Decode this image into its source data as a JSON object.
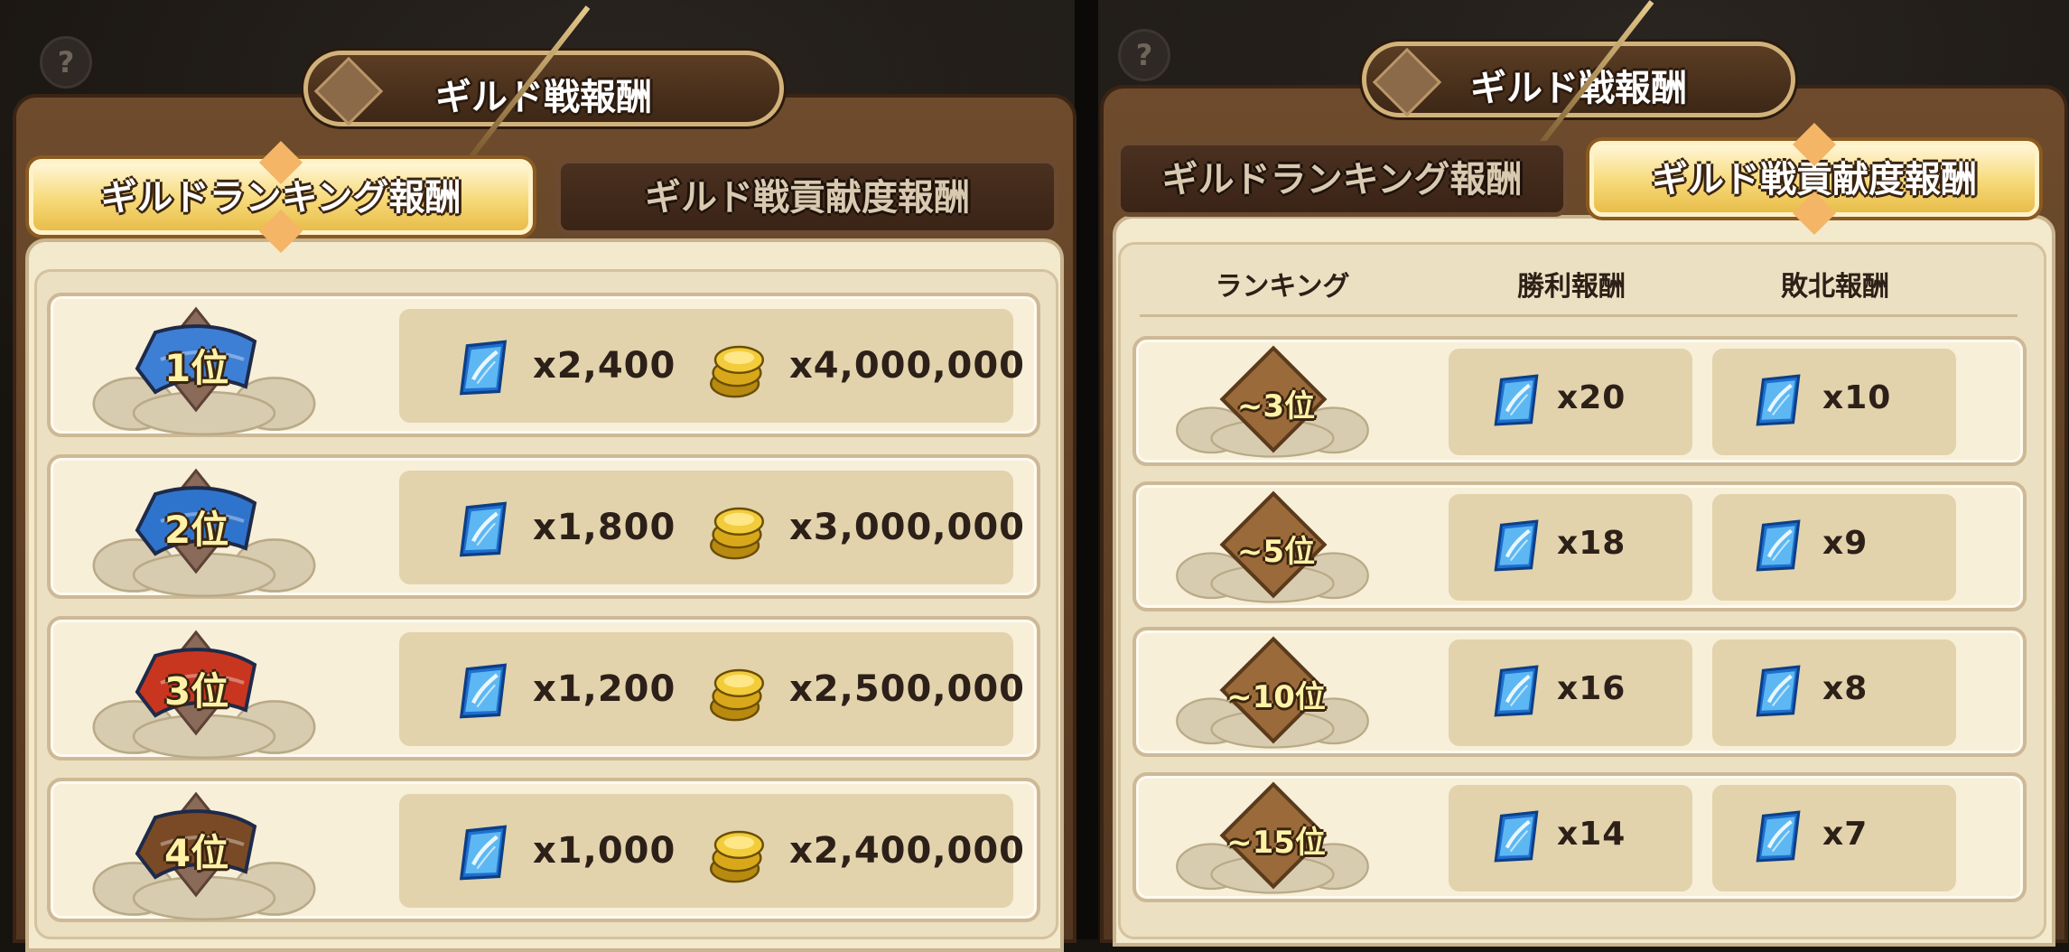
{
  "help_icon": "?",
  "left_panel": {
    "title": "ギルド戦報酬",
    "tabs": [
      {
        "label": "ギルドランキング報酬",
        "active": true
      },
      {
        "label": "ギルド戦貢献度報酬",
        "active": false
      }
    ],
    "rows": [
      {
        "rank": "1位",
        "fan_color": "#3e7fd6",
        "gem_qty": "x2,400",
        "coin_qty": "x4,000,000"
      },
      {
        "rank": "2位",
        "fan_color": "#2f74cc",
        "gem_qty": "x1,800",
        "coin_qty": "x3,000,000"
      },
      {
        "rank": "3位",
        "fan_color": "#c8361f",
        "gem_qty": "x1,200",
        "coin_qty": "x2,500,000"
      },
      {
        "rank": "4位",
        "fan_color": "#7a4a26",
        "gem_qty": "x1,000",
        "coin_qty": "x2,400,000"
      }
    ]
  },
  "right_panel": {
    "title": "ギルド戦報酬",
    "tabs": [
      {
        "label": "ギルドランキング報酬",
        "active": false
      },
      {
        "label": "ギルド戦貢献度報酬",
        "active": true
      }
    ],
    "headers": {
      "ranking": "ランキング",
      "win": "勝利報酬",
      "lose": "敗北報酬"
    },
    "rows": [
      {
        "rank": "~3位",
        "win_qty": "x20",
        "lose_qty": "x10"
      },
      {
        "rank": "~5位",
        "win_qty": "x18",
        "lose_qty": "x9"
      },
      {
        "rank": "~10位",
        "win_qty": "x16",
        "lose_qty": "x8"
      },
      {
        "rank": "~15位",
        "win_qty": "x14",
        "lose_qty": "x7"
      }
    ]
  },
  "icons": {
    "gem": "blue-crystal-gem-icon",
    "coin": "gold-coin-stack-icon",
    "rank_badge": "fan-rank-badge-icon"
  }
}
